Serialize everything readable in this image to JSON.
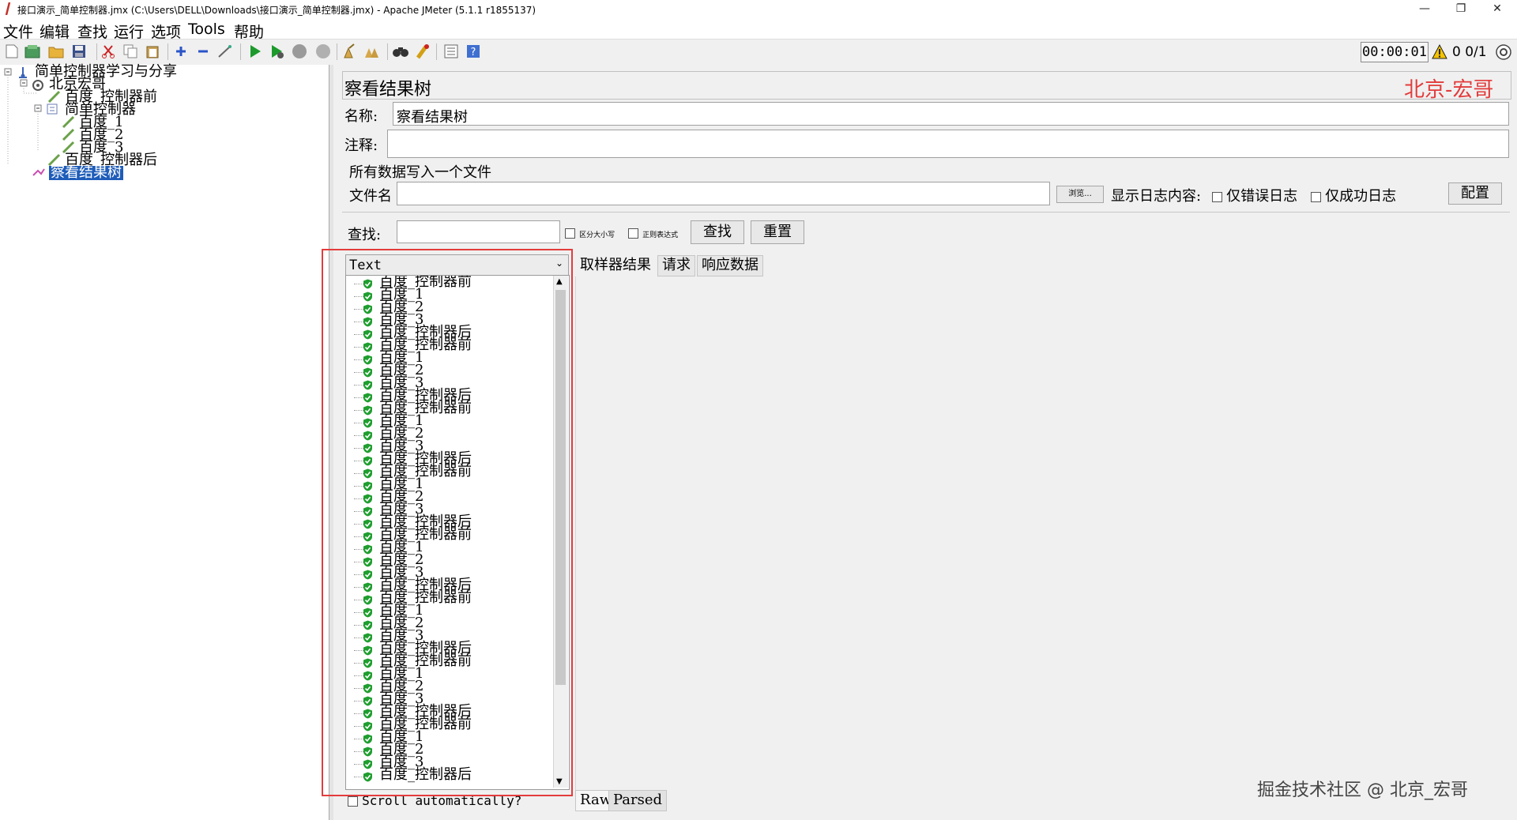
{
  "window": {
    "title": "接口演示_简单控制器.jmx (C:\\Users\\DELL\\Downloads\\接口演示_简单控制器.jmx) - Apache JMeter (5.1.1 r1855137)",
    "minimize": "—",
    "restore": "❐",
    "close": "✕"
  },
  "menu": [
    "文件",
    "编辑",
    "查找",
    "运行",
    "选项",
    "Tools",
    "帮助"
  ],
  "status": {
    "timer": "00:00:01",
    "warnings": "0",
    "threads": "0/1"
  },
  "tree": [
    {
      "label": "简单控制器学习与分享",
      "icon": "testplan-icon"
    },
    {
      "label": "北京宏哥",
      "icon": "thread-group-icon"
    },
    {
      "label": "百度_控制器前",
      "icon": "sampler-icon"
    },
    {
      "label": "简单控制器",
      "icon": "controller-icon"
    },
    {
      "label": "百度_1",
      "icon": "sampler-icon"
    },
    {
      "label": "百度_2",
      "icon": "sampler-icon"
    },
    {
      "label": "百度_3",
      "icon": "sampler-icon"
    },
    {
      "label": "百度_控制器后",
      "icon": "sampler-icon"
    },
    {
      "label": "察看结果树",
      "icon": "listener-icon"
    }
  ],
  "panel": {
    "title": "察看结果树",
    "name_label": "名称:",
    "name_value": "察看结果树",
    "comment_label": "注释:",
    "file_section": "所有数据写入一个文件",
    "file_label": "文件名",
    "browse": "浏览...",
    "log_label": "显示日志内容:",
    "errors_only": "仅错误日志",
    "success_only": "仅成功日志",
    "configure": "配置",
    "search_label": "查找:",
    "case_sensitive": "区分大小写",
    "regex": "正则表达式",
    "find": "查找",
    "reset": "重置",
    "renderer": "Text",
    "tabs": [
      "取样器结果",
      "请求",
      "响应数据"
    ],
    "scroll_auto": "Scroll automatically?",
    "bottom_tabs": [
      "Raw",
      "Parsed"
    ]
  },
  "results": [
    "百度_控制器前",
    "百度_1",
    "百度_2",
    "百度_3",
    "百度_控制器后",
    "百度_控制器前",
    "百度_1",
    "百度_2",
    "百度_3",
    "百度_控制器后",
    "百度_控制器前",
    "百度_1",
    "百度_2",
    "百度_3",
    "百度_控制器后",
    "百度_控制器前",
    "百度_1",
    "百度_2",
    "百度_3",
    "百度_控制器后",
    "百度_控制器前",
    "百度_1",
    "百度_2",
    "百度_3",
    "百度_控制器后",
    "百度_控制器前",
    "百度_1",
    "百度_2",
    "百度_3",
    "百度_控制器后",
    "百度_控制器前",
    "百度_1",
    "百度_2",
    "百度_3",
    "百度_控制器后",
    "百度_控制器前",
    "百度_1",
    "百度_2",
    "百度_3",
    "百度_控制器后"
  ],
  "watermarks": {
    "top_right": "北京-宏哥",
    "bottom_right": "掘金技术社区 @ 北京_宏哥"
  },
  "colors": {
    "selection": "#1e5cb9",
    "highlight_frame": "#e33c3c",
    "watermark": "#e23b3b",
    "success": "#1f9e2f"
  }
}
